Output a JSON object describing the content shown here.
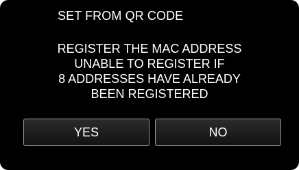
{
  "dialog": {
    "title": "SET FROM QR CODE",
    "message_lines": [
      "REGISTER THE MAC ADDRESS",
      "UNABLE TO REGISTER IF",
      "8 ADDRESSES HAVE ALREADY",
      "BEEN REGISTERED"
    ],
    "yes_label": "YES",
    "no_label": "NO"
  },
  "colors": {
    "background": "#000000",
    "text": "#ffffff",
    "button_border": "#9a9a9a"
  }
}
